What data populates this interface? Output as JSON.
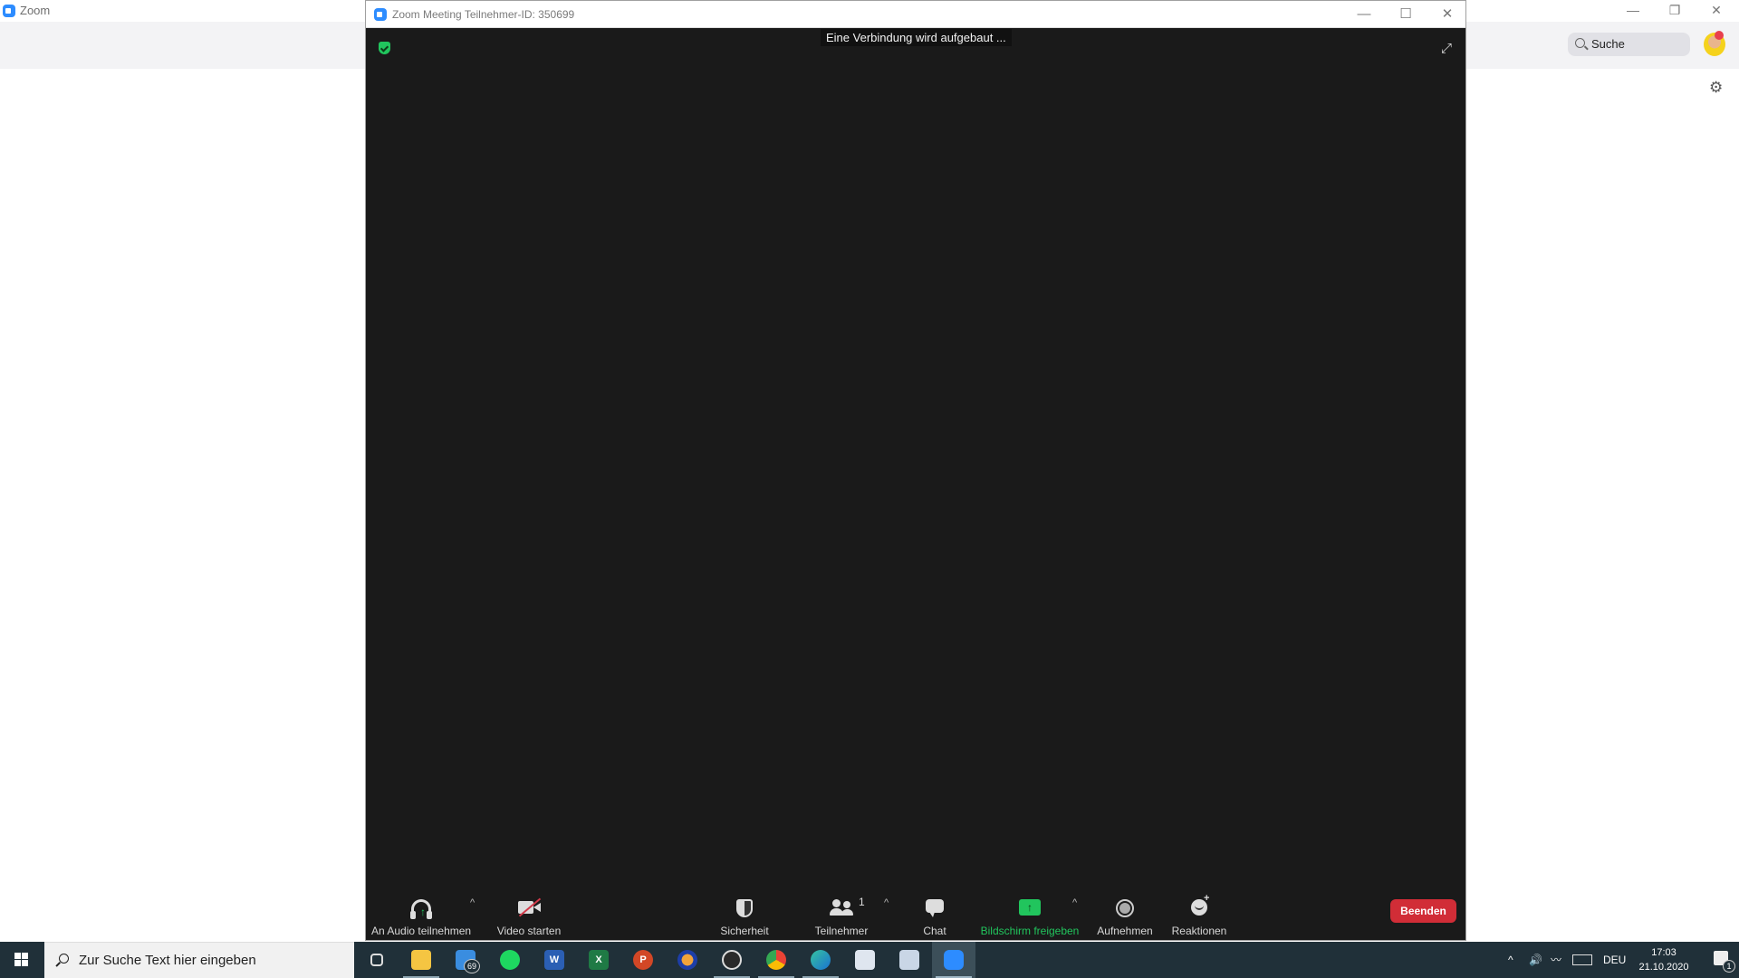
{
  "background_app": {
    "title": "Zoom",
    "window_controls": {
      "minimize": "—",
      "restore": "❐",
      "close": "✕"
    },
    "search": {
      "placeholder": "Suche"
    },
    "settings_icon": "gear-icon",
    "avatar_status_color": "#e8404d"
  },
  "meeting_window": {
    "title": "Zoom Meeting Teilnehmer-ID: 350699",
    "window_controls": {
      "minimize": "—",
      "maximize": "☐",
      "close": "✕"
    },
    "status_message": "Eine Verbindung wird aufgebaut ...",
    "encryption_badge_color": "#21c55d",
    "fullscreen_icon": "⤢",
    "toolbar": {
      "audio": {
        "label": "An Audio teilnehmen",
        "icon": "headphones-icon"
      },
      "video": {
        "label": "Video starten",
        "icon": "video-off-icon"
      },
      "security": {
        "label": "Sicherheit",
        "icon": "shield-icon"
      },
      "participants": {
        "label": "Teilnehmer",
        "count": "1",
        "icon": "participants-icon"
      },
      "chat": {
        "label": "Chat",
        "icon": "chat-icon"
      },
      "share": {
        "label": "Bildschirm freigeben",
        "icon": "share-screen-icon",
        "color": "#21c55d",
        "arrow": "↑"
      },
      "record": {
        "label": "Aufnehmen",
        "icon": "record-icon"
      },
      "reactions": {
        "label": "Reaktionen",
        "icon": "reactions-icon",
        "plus": "+"
      },
      "caret": "^",
      "end": {
        "label": "Beenden",
        "color": "#d12d37"
      }
    }
  },
  "taskbar": {
    "search_placeholder": "Zur Suche Text hier eingeben",
    "apps": [
      {
        "name": "task-view",
        "letter": ""
      },
      {
        "name": "file-explorer",
        "letter": ""
      },
      {
        "name": "mail",
        "letter": "",
        "badge": "69"
      },
      {
        "name": "spotify",
        "letter": ""
      },
      {
        "name": "word",
        "letter": "W"
      },
      {
        "name": "excel",
        "letter": "X"
      },
      {
        "name": "powerpoint",
        "letter": "P"
      },
      {
        "name": "audacity",
        "letter": ""
      },
      {
        "name": "obs-studio",
        "letter": ""
      },
      {
        "name": "chrome",
        "letter": ""
      },
      {
        "name": "edge",
        "letter": ""
      },
      {
        "name": "app-1",
        "letter": ""
      },
      {
        "name": "app-2",
        "letter": ""
      },
      {
        "name": "zoom",
        "letter": ""
      }
    ],
    "tray": {
      "chevron": "^",
      "volume": "🔊",
      "language": "DEU",
      "time": "17:03",
      "date": "21.10.2020",
      "notifications_count": "1"
    }
  }
}
